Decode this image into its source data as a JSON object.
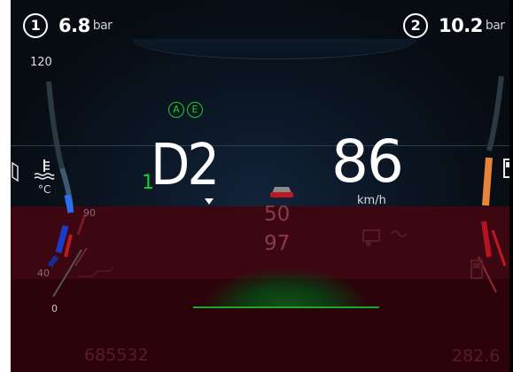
{
  "brake_pressure": {
    "circuit1": {
      "label": "1",
      "value": "6.8",
      "unit": "bar"
    },
    "circuit2": {
      "label": "2",
      "value": "10.2",
      "unit": "bar"
    }
  },
  "speedometer": {
    "scale_max_label": "120",
    "speed": "86",
    "unit": "km/h"
  },
  "temperature_gauge": {
    "unit": "°C",
    "tick_90": "90",
    "tick_40": "40",
    "tick_0": "0"
  },
  "transmission": {
    "gear": "D2",
    "gear_step": "1",
    "mode_indicators": [
      "A",
      "E"
    ]
  },
  "cruise": {
    "speed_limit": "50",
    "set_speed": "97"
  },
  "odometer": {
    "total": "685532",
    "trip": "282.6"
  },
  "colors": {
    "accent_green": "#18d02c",
    "warning_red": "#3c0711",
    "temp_blue": "#2a6ff0",
    "temp_orange": "#e8843a"
  }
}
